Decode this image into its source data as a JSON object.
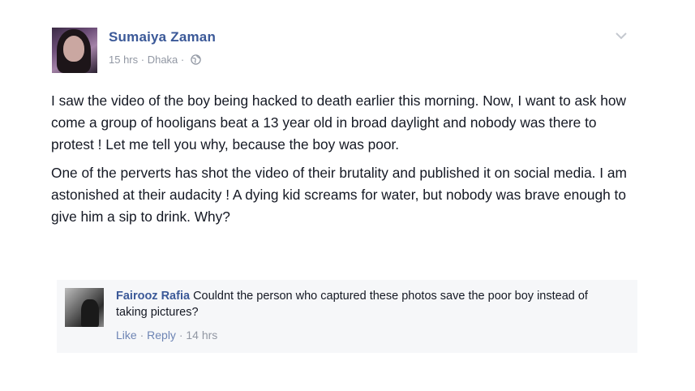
{
  "post": {
    "author": "Sumaiya Zaman",
    "time": "15 hrs",
    "separator": " · ",
    "location": "Dhaka",
    "audience_icon": "globe-icon",
    "menu_icon": "chevron-down-icon",
    "paragraphs": [
      "I saw the video of the boy being hacked to death earlier this morning. Now, I want to ask how come a group of hooligans beat a 13 year old in broad daylight and nobody was there to protest ! Let me tell you why, because the boy was poor.",
      "One of the perverts has shot the video of their brutality and published it on social media. I am astonished at their audacity ! A dying kid screams for water, but nobody was brave enough to give him a sip to drink. Why?"
    ]
  },
  "comment": {
    "author": "Fairooz Rafia",
    "text": " Couldnt the person who captured these photos save the poor boy instead of taking pictures?",
    "like_label": "Like",
    "reply_label": "Reply",
    "separator": " · ",
    "time": "14 hrs"
  },
  "colors": {
    "link_blue": "#3b5998",
    "meta_gray": "#9197a3",
    "comment_bg": "#f6f7f9"
  }
}
